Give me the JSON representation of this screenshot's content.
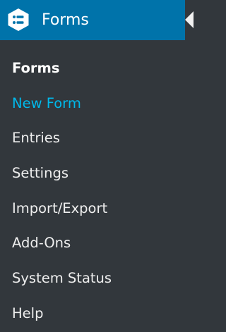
{
  "header": {
    "title": "Forms",
    "icon": "gravity-forms-icon",
    "background_color": "#0073aa"
  },
  "submenu": {
    "items": [
      {
        "label": "Forms",
        "state": "current"
      },
      {
        "label": "New Form",
        "state": "hover"
      },
      {
        "label": "Entries",
        "state": "normal"
      },
      {
        "label": "Settings",
        "state": "normal"
      },
      {
        "label": "Import/Export",
        "state": "normal"
      },
      {
        "label": "Add-Ons",
        "state": "normal"
      },
      {
        "label": "System Status",
        "state": "normal"
      },
      {
        "label": "Help",
        "state": "normal"
      }
    ]
  },
  "colors": {
    "menu_background": "#32373c",
    "text": "#eeeeee",
    "current_text": "#ffffff",
    "hover_text": "#00b9eb"
  }
}
